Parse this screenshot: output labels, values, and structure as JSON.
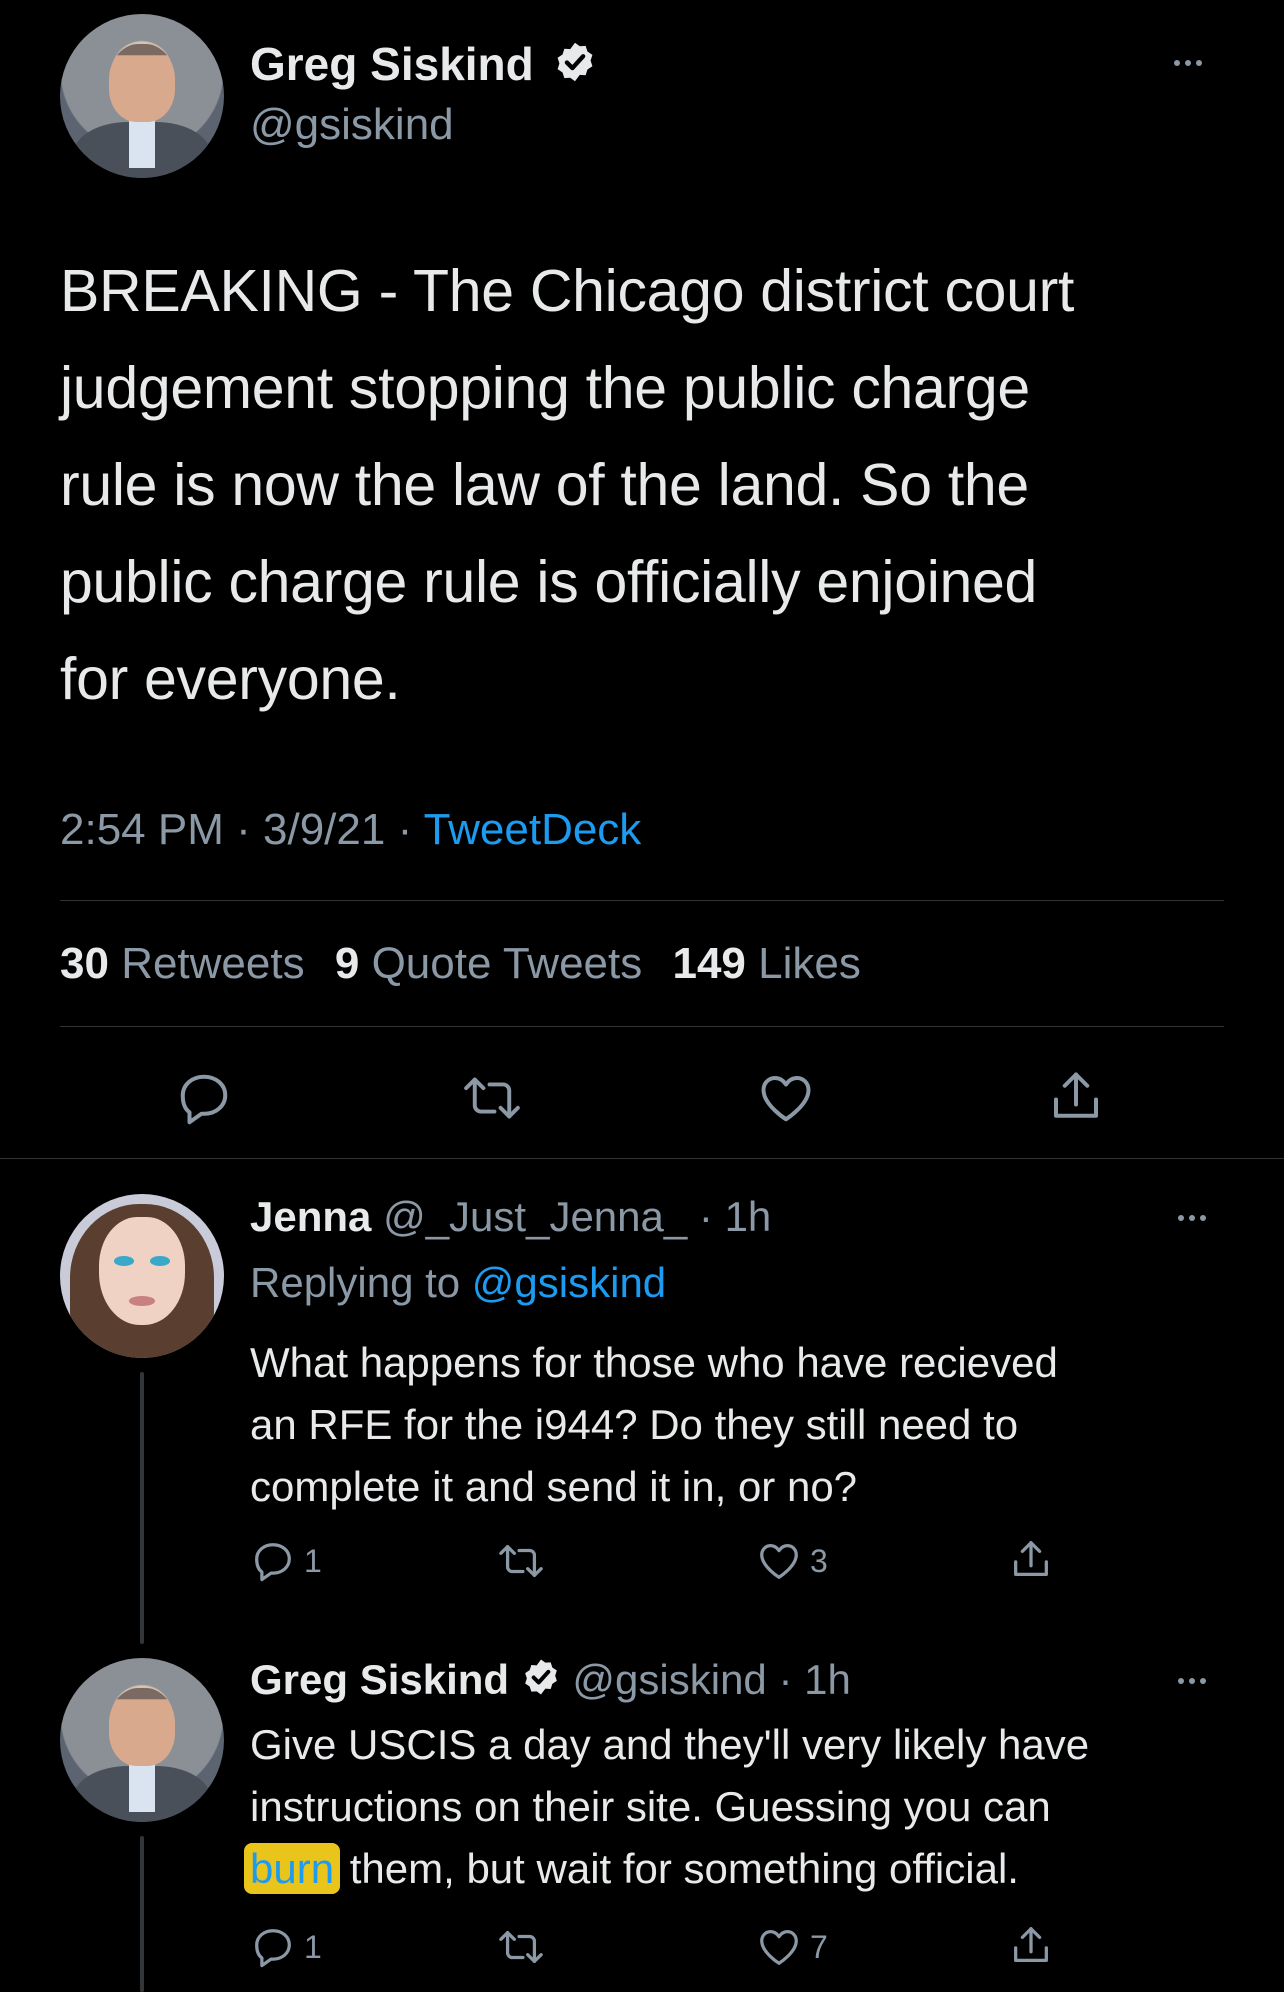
{
  "main_tweet": {
    "author_name": "Greg Siskind",
    "author_handle": "@gsiskind",
    "text_lines": [
      "BREAKING - The Chicago district court",
      "judgement stopping the public charge",
      "rule is now the law of the land. So the",
      "public charge rule is officially enjoined",
      "for everyone."
    ],
    "time": "2:54 PM",
    "date": "3/9/21",
    "separator": "·",
    "source": "TweetDeck",
    "stats": {
      "retweets_count": "30",
      "retweets_label": "Retweets",
      "quotes_count": "9",
      "quotes_label": "Quote Tweets",
      "likes_count": "149",
      "likes_label": "Likes"
    }
  },
  "replies": [
    {
      "author_name": "Jenna",
      "author_handle": "@_Just_Jenna_",
      "time": "1h",
      "separator": "·",
      "replying_prefix": "Replying to",
      "replying_to": "@gsiskind",
      "text_lines": [
        "What happens for those who have recieved",
        "an RFE for the i944? Do they still need to",
        "complete it and send it in, or no?"
      ],
      "reply_count": "1",
      "retweet_count": "",
      "like_count": "3"
    },
    {
      "author_name": "Greg Siskind",
      "author_handle": "@gsiskind",
      "time": "1h",
      "separator": "·",
      "text_lines": [
        "Give USCIS a day and they'll very likely have",
        "instructions on their site. Guessing you can"
      ],
      "highlighted_word": "burn",
      "text_after_highlight": "them, but wait for something official.",
      "reply_count": "1",
      "retweet_count": "",
      "like_count": "7"
    }
  ],
  "icons": {
    "verified": "verified-badge-icon",
    "more": "more-options-icon",
    "reply": "reply-icon",
    "retweet": "retweet-icon",
    "like": "heart-icon",
    "share": "share-icon"
  },
  "colors": {
    "background": "#000000",
    "text": "#e7e9ea",
    "muted": "#8b98a5",
    "link": "#1d9bf0",
    "highlight": "#e9c51c"
  }
}
